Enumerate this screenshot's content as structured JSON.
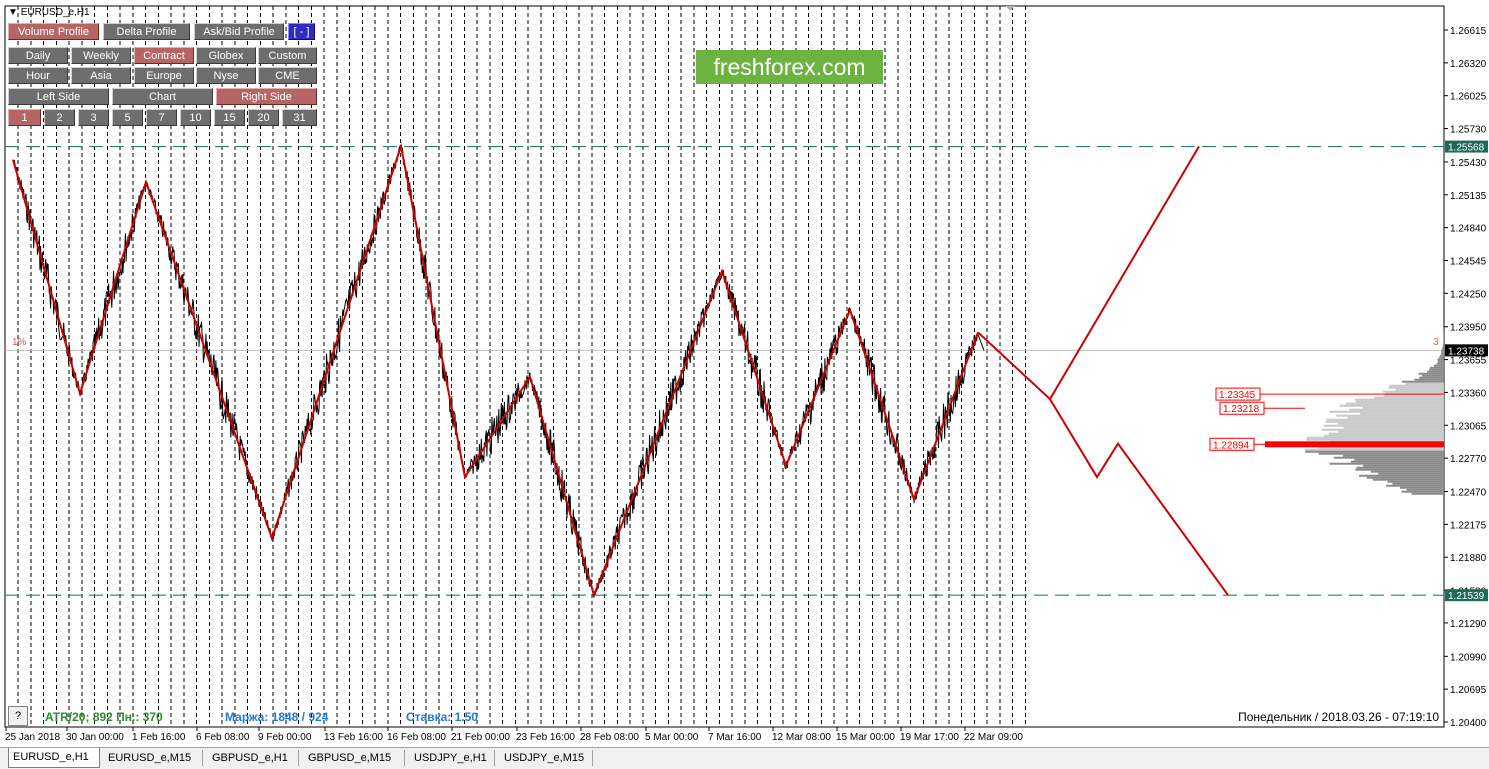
{
  "window_title": "EURUSD_e,H1",
  "logo_text": "freshforex.com",
  "datetime_label": "Понедельник  /  2018.03.26  -  07:19:10",
  "help_button": "?",
  "stats": {
    "atr": "ATR/20; 892  Пн.: 370",
    "margin": "Маржа: 1848 / 924",
    "rate": "Ставка: 1.50"
  },
  "corner_label_left": "1%",
  "corner_label_right": "3",
  "toolbar": {
    "row1": [
      {
        "label": "Volume Profile",
        "style": "red"
      },
      {
        "label": "Delta Profile",
        "style": "gray"
      },
      {
        "label": "Ask/Bid Profile",
        "style": "gray"
      },
      {
        "label": "[ - ]",
        "style": "blue"
      }
    ],
    "row2": [
      {
        "label": "Daily",
        "style": "gray"
      },
      {
        "label": "Weekly",
        "style": "gray"
      },
      {
        "label": "Contract",
        "style": "red"
      },
      {
        "label": "Globex",
        "style": "gray"
      },
      {
        "label": "Custom",
        "style": "gray"
      }
    ],
    "row3": [
      {
        "label": "Hour",
        "style": "gray"
      },
      {
        "label": "Asia",
        "style": "gray"
      },
      {
        "label": "Europe",
        "style": "gray"
      },
      {
        "label": "Nyse",
        "style": "gray"
      },
      {
        "label": "CME",
        "style": "gray"
      }
    ],
    "row4": [
      {
        "label": "Left Side",
        "style": "gray"
      },
      {
        "label": "Chart",
        "style": "gray"
      },
      {
        "label": "Right Side",
        "style": "red"
      }
    ],
    "row5": [
      {
        "label": "1",
        "style": "red"
      },
      {
        "label": "2",
        "style": "gray"
      },
      {
        "label": "3",
        "style": "gray"
      },
      {
        "label": "5",
        "style": "gray"
      },
      {
        "label": "7",
        "style": "gray"
      },
      {
        "label": "10",
        "style": "gray"
      },
      {
        "label": "15",
        "style": "gray"
      },
      {
        "label": "20",
        "style": "gray"
      },
      {
        "label": "31",
        "style": "gray"
      }
    ]
  },
  "tabs": [
    "EURUSD_e,H1",
    "EURUSD_e,M15",
    "GBPUSD_e,H1",
    "GBPUSD_e,M15",
    "USDJPY_e,H1",
    "USDJPY_e,M15"
  ],
  "active_tab": 0,
  "colors": {
    "zigzag": "#cc0000",
    "price": "#000000",
    "level_line": "#2e7d6e",
    "profile_gray": "#a8a8a8",
    "profile_poc": "#ff0000",
    "level_tag": "#1f6b5a",
    "current_tag": "#000000",
    "atr_text": "#2e8b2e",
    "margin_text": "#1e7bd6"
  },
  "chart_data": {
    "type": "line",
    "symbol": "EURUSD_e",
    "timeframe": "H1",
    "y_ticks": [
      "1.26615",
      "1.26320",
      "1.26025",
      "1.25730",
      "1.25430",
      "1.25135",
      "1.24840",
      "1.24545",
      "1.24250",
      "1.23950",
      "1.23655",
      "1.23360",
      "1.23065",
      "1.22770",
      "1.22470",
      "1.22175",
      "1.21880",
      "1.21580",
      "1.21290",
      "1.20990",
      "1.20695",
      "1.20400"
    ],
    "ylim": [
      1.2025,
      1.2675
    ],
    "x_ticks": [
      "25 Jan 2018",
      "30 Jan 00:00",
      "1 Feb 16:00",
      "6 Feb 08:00",
      "9 Feb 00:00",
      "13 Feb 16:00",
      "16 Feb 08:00",
      "21 Feb 00:00",
      "23 Feb 16:00",
      "28 Feb 08:00",
      "5 Mar 00:00",
      "7 Mar 16:00",
      "12 Mar 08:00",
      "15 Mar 00:00",
      "19 Mar 17:00",
      "22 Mar 09:00"
    ],
    "horizontal_levels": [
      {
        "value": 1.25568,
        "label": "1.25568"
      },
      {
        "value": 1.21539,
        "label": "1.21539"
      }
    ],
    "current_price": {
      "value": 1.23738,
      "label": "1.23738"
    },
    "zigzag": {
      "points": [
        {
          "x": "25 Jan 2018",
          "y": 1.2545
        },
        {
          "x": "30 Jan 00:00",
          "y": 1.2335
        },
        {
          "x": "1 Feb 16:00",
          "y": 1.2525
        },
        {
          "x": "9 Feb 00:00",
          "y": 1.2205
        },
        {
          "x": "16 Feb 08:00",
          "y": 1.2557
        },
        {
          "x": "21 Feb 00:00",
          "y": 1.226
        },
        {
          "x": "23 Feb 16:00",
          "y": 1.235
        },
        {
          "x": "28 Feb 08:00",
          "y": 1.2154
        },
        {
          "x": "7 Mar 16:00",
          "y": 1.2445
        },
        {
          "x": "12 Mar 08:00",
          "y": 1.227
        },
        {
          "x": "15 Mar 00:00",
          "y": 1.241
        },
        {
          "x": "19 Mar 17:00",
          "y": 1.224
        },
        {
          "x": "22 Mar 09:00",
          "y": 1.239
        }
      ]
    },
    "forecast_paths": [
      {
        "points": [
          {
            "x": "22 Mar 09:00",
            "y": 1.239
          },
          {
            "x": "proj-1",
            "y": 1.233
          },
          {
            "x": "proj-4",
            "y": 1.2557
          }
        ]
      },
      {
        "points": [
          {
            "x": "proj-1",
            "y": 1.233
          },
          {
            "x": "proj-2",
            "y": 1.226
          },
          {
            "x": "proj-3",
            "y": 1.229
          },
          {
            "x": "proj-5",
            "y": 1.2154
          }
        ]
      }
    ],
    "volume_profile": {
      "levels": [
        {
          "value": 1.23345,
          "label": "1.23345"
        },
        {
          "value": 1.23218,
          "label": "1.23218"
        },
        {
          "value": 1.22894,
          "label": "1.22894",
          "poc": true
        }
      ],
      "price_range": [
        1.2245,
        1.2395
      ]
    }
  }
}
